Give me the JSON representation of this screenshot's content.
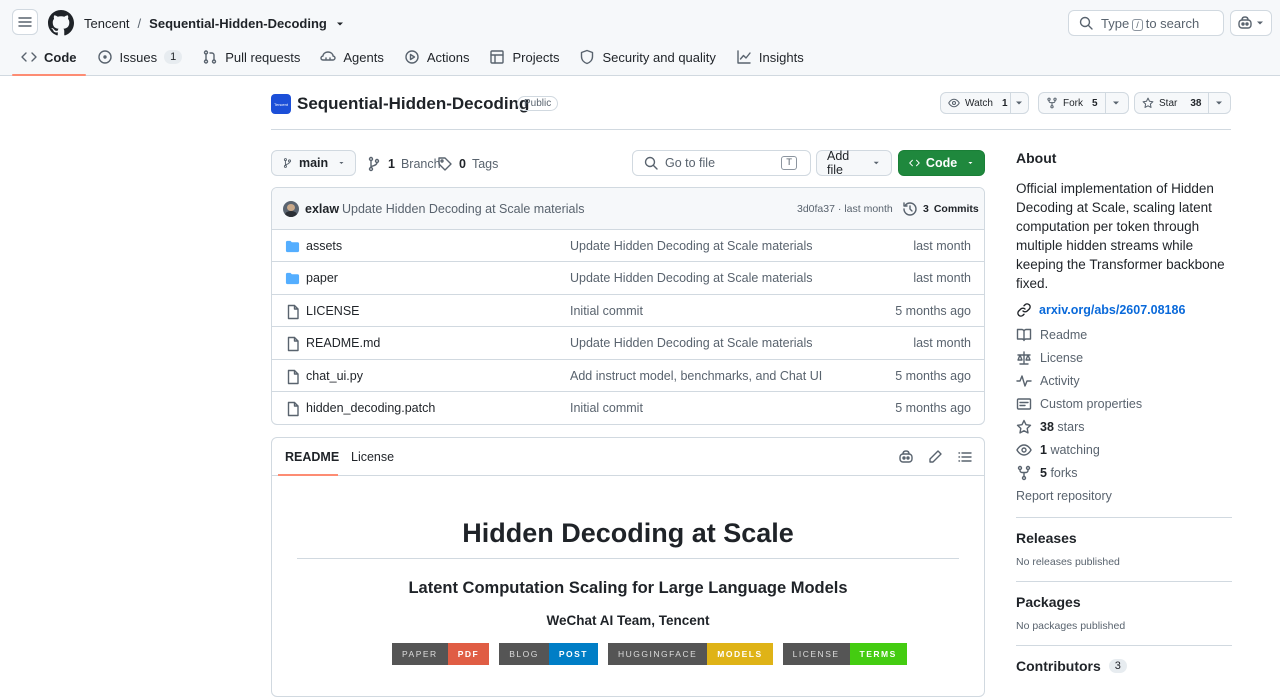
{
  "header": {
    "owner": "Tencent",
    "separator": "/",
    "repo": "Sequential-Hidden-Decoding",
    "search_placeholder_prefix": "Type",
    "search_key": "/",
    "search_placeholder_suffix": "to search"
  },
  "nav_tabs": [
    {
      "label": "Code",
      "icon": "code-icon",
      "active": true
    },
    {
      "label": "Issues",
      "icon": "issue-icon",
      "count": "1"
    },
    {
      "label": "Pull requests",
      "icon": "pull-request-icon"
    },
    {
      "label": "Agents",
      "icon": "agents-icon"
    },
    {
      "label": "Actions",
      "icon": "play-icon"
    },
    {
      "label": "Projects",
      "icon": "table-icon"
    },
    {
      "label": "Security and quality",
      "icon": "shield-icon"
    },
    {
      "label": "Insights",
      "icon": "graph-icon"
    }
  ],
  "repo": {
    "name": "Sequential-Hidden-Decoding",
    "visibility": "Public",
    "logo_text": "Tencent",
    "watch_label": "Watch",
    "watch_count": "1",
    "fork_label": "Fork",
    "fork_count": "5",
    "star_label": "Star",
    "star_count": "38"
  },
  "toolbar": {
    "branch": "main",
    "branches_count": "1",
    "branches_label": "Branch",
    "tags_count": "0",
    "tags_label": "Tags",
    "goto_placeholder": "Go to file",
    "goto_key": "T",
    "add_file": "Add file",
    "code_btn": "Code"
  },
  "commit": {
    "author": "exlaw",
    "message": "Update Hidden Decoding at Scale materials",
    "hash": "3d0fa37",
    "dot": "·",
    "time": "last month",
    "commits_count": "3",
    "commits_label": "Commits"
  },
  "files": [
    {
      "name": "assets",
      "type": "dir",
      "message": "Update Hidden Decoding at Scale materials",
      "time": "last month"
    },
    {
      "name": "paper",
      "type": "dir",
      "message": "Update Hidden Decoding at Scale materials",
      "time": "last month"
    },
    {
      "name": "LICENSE",
      "type": "file",
      "message": "Initial commit",
      "time": "5 months ago"
    },
    {
      "name": "README.md",
      "type": "file",
      "message": "Update Hidden Decoding at Scale materials",
      "time": "last month"
    },
    {
      "name": "chat_ui.py",
      "type": "file",
      "message": "Add instruct model, benchmarks, and Chat UI",
      "time": "5 months ago"
    },
    {
      "name": "hidden_decoding.patch",
      "type": "file",
      "message": "Initial commit",
      "time": "5 months ago"
    }
  ],
  "readme": {
    "tab_readme": "README",
    "tab_license": "License",
    "title": "Hidden Decoding at Scale",
    "subtitle": "Latent Computation Scaling for Large Language Models",
    "team": "WeChat AI Team, Tencent",
    "badges": [
      {
        "left": "PAPER",
        "right": "PDF",
        "color": "#e05d44"
      },
      {
        "left": "BLOG",
        "right": "POST",
        "color": "#007ec6"
      },
      {
        "left": "HUGGINGFACE",
        "right": "MODELS",
        "color": "#dfb317"
      },
      {
        "left": "LICENSE",
        "right": "TERMS",
        "color": "#4c1"
      }
    ]
  },
  "about": {
    "heading": "About",
    "description": "Official implementation of Hidden Decoding at Scale, scaling latent computation per token through multiple hidden streams while keeping the Transformer backbone fixed.",
    "link": "arxiv.org/abs/2607.08186",
    "items": [
      {
        "label": "Readme",
        "icon": "book-icon"
      },
      {
        "label": "License",
        "icon": "law-icon"
      },
      {
        "label": "Activity",
        "icon": "pulse-icon"
      },
      {
        "label": "Custom properties",
        "icon": "note-icon"
      }
    ],
    "stars_count": "38",
    "stars_label": "stars",
    "watching_count": "1",
    "watching_label": "watching",
    "forks_count": "5",
    "forks_label": "forks",
    "report": "Report repository"
  },
  "releases": {
    "heading": "Releases",
    "text": "No releases published"
  },
  "packages": {
    "heading": "Packages",
    "text": "No packages published"
  },
  "contributors": {
    "heading": "Contributors",
    "count": "3"
  },
  "colors": {
    "accent": "#fd8c73",
    "green": "#1f883d",
    "link": "#0969da",
    "folder": "#54aeff"
  }
}
